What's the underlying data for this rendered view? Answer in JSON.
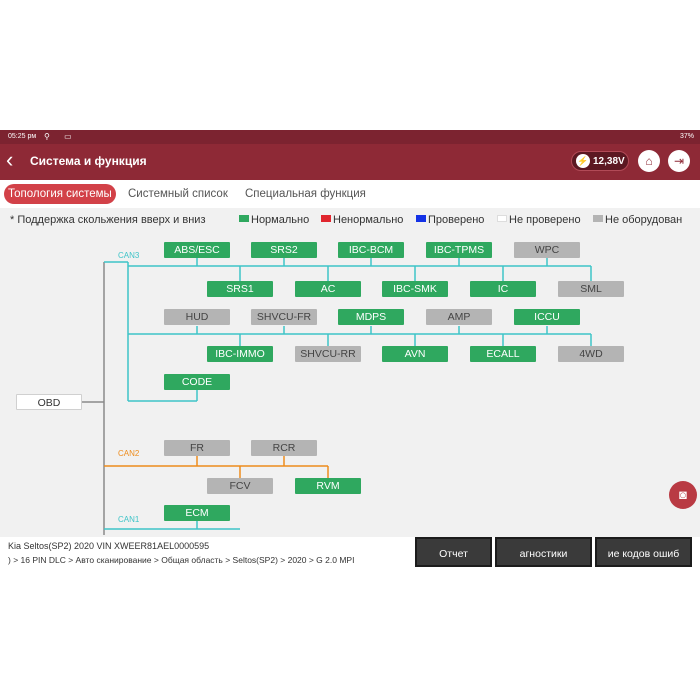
{
  "status_bar": {
    "time": "05:25 рм",
    "battery": "37%"
  },
  "header": {
    "back_icon": "chevron-left",
    "title": "Система и функция",
    "voltage": "12,38V",
    "home_icon": "home",
    "exit_icon": "exit"
  },
  "tabs": [
    {
      "label": "Топология системы",
      "active": true
    },
    {
      "label": "Системный список",
      "active": false
    },
    {
      "label": "Специальная функция",
      "active": false
    }
  ],
  "legend": {
    "note": "* Поддержка скольжения вверх и вниз",
    "items": [
      {
        "label": "Нормально",
        "color": "#2fa85f"
      },
      {
        "label": "Ненормально",
        "color": "#e0262e"
      },
      {
        "label": "Проверено",
        "color": "#1432e6"
      },
      {
        "label": "Не проверено",
        "color": "#ffffff"
      },
      {
        "label": "Не оборудован",
        "color": "#b4b4b4"
      }
    ]
  },
  "topology": {
    "root": "OBD",
    "buses": [
      {
        "name": "CAN3",
        "color": "#3ec4c8"
      },
      {
        "name": "CAN2",
        "color": "#ee8c1c"
      },
      {
        "name": "CAN1",
        "color": "#3ec4c8"
      }
    ],
    "modules": [
      {
        "label": "ABS/ESC",
        "status": "normal"
      },
      {
        "label": "SRS2",
        "status": "normal"
      },
      {
        "label": "IBC-BCM",
        "status": "normal"
      },
      {
        "label": "IBC-TPMS",
        "status": "normal"
      },
      {
        "label": "WPC",
        "status": "not_equipped"
      },
      {
        "label": "SRS1",
        "status": "normal"
      },
      {
        "label": "AC",
        "status": "normal"
      },
      {
        "label": "IBC-SMK",
        "status": "normal"
      },
      {
        "label": "IC",
        "status": "normal"
      },
      {
        "label": "SML",
        "status": "not_equipped"
      },
      {
        "label": "HUD",
        "status": "not_equipped"
      },
      {
        "label": "SHVCU-FR",
        "status": "not_equipped"
      },
      {
        "label": "MDPS",
        "status": "normal"
      },
      {
        "label": "AMP",
        "status": "not_equipped"
      },
      {
        "label": "ICCU",
        "status": "normal"
      },
      {
        "label": "IBC-IMMO",
        "status": "normal"
      },
      {
        "label": "SHVCU-RR",
        "status": "not_equipped"
      },
      {
        "label": "AVN",
        "status": "normal"
      },
      {
        "label": "ECALL",
        "status": "normal"
      },
      {
        "label": "4WD",
        "status": "not_equipped"
      },
      {
        "label": "CODE",
        "status": "normal"
      },
      {
        "label": "FR",
        "status": "not_equipped"
      },
      {
        "label": "RCR",
        "status": "not_equipped"
      },
      {
        "label": "FCV",
        "status": "not_equipped"
      },
      {
        "label": "RVM",
        "status": "normal"
      },
      {
        "label": "ECM",
        "status": "normal"
      }
    ]
  },
  "vehicle_info": "Kia   Seltos(SP2)   2020   VIN   XWEER81AEL0000595",
  "breadcrumb": ") > 16 PIN DLC > Авто сканирование > Общая область > Seltos(SP2) > 2020 > G 2.0 MPI",
  "buttons": {
    "report": "Отчет",
    "diagnostics": "агностики",
    "clear_codes": "ие кодов ошиб"
  },
  "camera_icon": "camera"
}
